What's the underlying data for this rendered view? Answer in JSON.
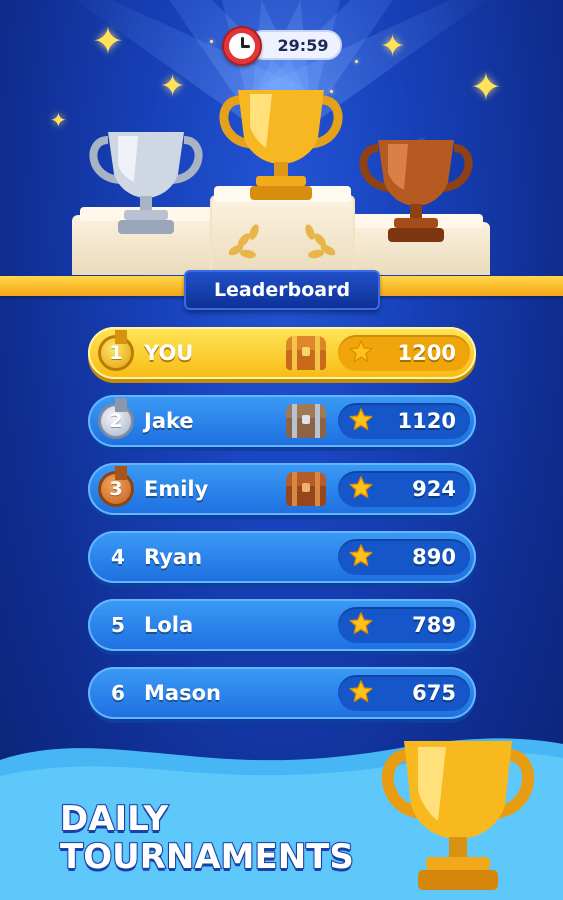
{
  "timer": {
    "value": "29:59",
    "icon": "clock-icon"
  },
  "banner": {
    "title": "Leaderboard"
  },
  "leaderboard": [
    {
      "rank": "1",
      "name": "YOU",
      "score": "1200",
      "medal": "gold",
      "chest": "gold",
      "highlight": true
    },
    {
      "rank": "2",
      "name": "Jake",
      "score": "1120",
      "medal": "silver",
      "chest": "silver",
      "highlight": false
    },
    {
      "rank": "3",
      "name": "Emily",
      "score": "924",
      "medal": "bronze",
      "chest": "bronze",
      "highlight": false
    },
    {
      "rank": "4",
      "name": "Ryan",
      "score": "890",
      "medal": null,
      "chest": null,
      "highlight": false
    },
    {
      "rank": "5",
      "name": "Lola",
      "score": "789",
      "medal": null,
      "chest": null,
      "highlight": false
    },
    {
      "rank": "6",
      "name": "Mason",
      "score": "675",
      "medal": null,
      "chest": null,
      "highlight": false
    }
  ],
  "promo": {
    "line1": "DAILY",
    "line2": "TOURNAMENTS"
  },
  "colors": {
    "background": "#1740b8",
    "gold_row": "#f7bb13",
    "blue_row": "#1e6fe0",
    "banner_bar": "#f5a516",
    "star": "#ffc21a"
  }
}
